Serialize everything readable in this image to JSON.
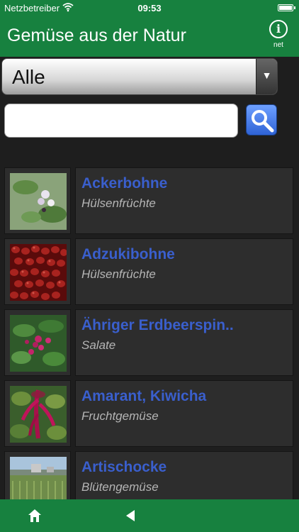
{
  "status_bar": {
    "carrier": "Netzbetreiber",
    "time": "09:53"
  },
  "header": {
    "title": "Gemüse aus der Natur",
    "info_label": "net"
  },
  "filter": {
    "selected": "Alle"
  },
  "search": {
    "value": "",
    "placeholder": ""
  },
  "items": [
    {
      "name": "Ackerbohne",
      "category": "Hülsenfrüchte"
    },
    {
      "name": "Adzukibohne",
      "category": "Hülsenfrüchte"
    },
    {
      "name": "Ähriger Erdbeerspin..",
      "category": "Salate"
    },
    {
      "name": "Amarant, Kiwicha",
      "category": "Fruchtgemüse"
    },
    {
      "name": "Artischocke",
      "category": "Blütengemüse"
    }
  ],
  "colors": {
    "accent": "#17813f",
    "link": "#3a5fcd"
  }
}
